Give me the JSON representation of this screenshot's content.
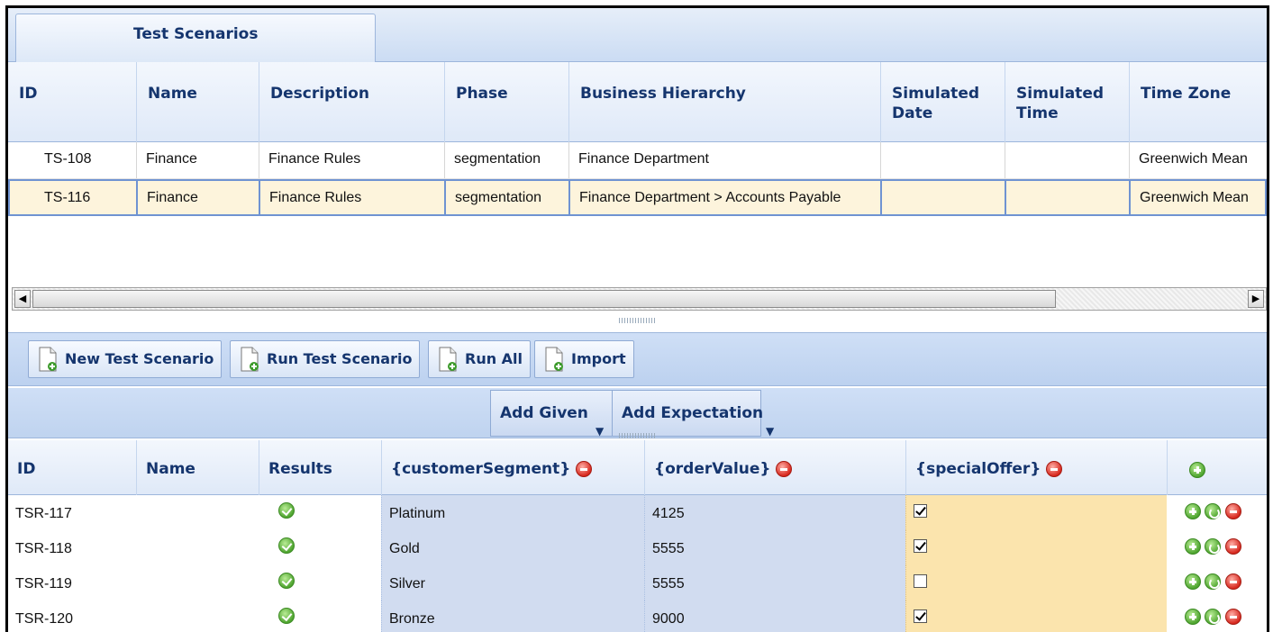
{
  "tabs": [
    {
      "label": "Test Scenarios"
    }
  ],
  "scenario_grid": {
    "columns": [
      "ID",
      "Name",
      "Description",
      "Phase",
      "Business Hierarchy",
      "Simulated Date",
      "Simulated Time",
      "Time Zone"
    ],
    "rows": [
      {
        "id": "TS-108",
        "name": "Finance",
        "description": "Finance Rules",
        "phase": "segmentation",
        "hierarchy": "Finance Department",
        "date": "",
        "time": "",
        "zone": "Greenwich Mean"
      },
      {
        "id": "TS-116",
        "name": "Finance",
        "description": "Finance Rules",
        "phase": "segmentation",
        "hierarchy": "Finance Department > Accounts Payable",
        "date": "",
        "time": "",
        "zone": "Greenwich Mean"
      }
    ],
    "selected_row": 1
  },
  "toolbar": {
    "new_label": "New Test Scenario",
    "run_label": "Run Test Scenario",
    "run_all_label": "Run All",
    "import_label": "Import"
  },
  "add_bar": {
    "given_label": "Add Given",
    "expectation_label": "Add Expectation"
  },
  "results_grid": {
    "columns": [
      "ID",
      "Name",
      "Results",
      "{customerSegment}",
      "{orderValue}",
      "{specialOffer}"
    ],
    "rows": [
      {
        "id": "TSR-117",
        "name": "",
        "result": "pass",
        "segment": "Platinum",
        "order": "4125",
        "offer": true
      },
      {
        "id": "TSR-118",
        "name": "",
        "result": "pass",
        "segment": "Gold",
        "order": "5555",
        "offer": true
      },
      {
        "id": "TSR-119",
        "name": "",
        "result": "pass",
        "segment": "Silver",
        "order": "5555",
        "offer": false
      },
      {
        "id": "TSR-120",
        "name": "",
        "result": "pass",
        "segment": "Bronze",
        "order": "9000",
        "offer": true
      }
    ]
  },
  "icons": {
    "result_pass": "check-circle-icon",
    "remove_column": "remove-circle-icon",
    "add": "add-circle-icon",
    "refresh": "refresh-icon",
    "document": "new-document-icon"
  },
  "colors": {
    "accent": "#15356e",
    "selected_row": "#fdf4dc",
    "given_column": "#d1dcf0",
    "expectation_column": "#fbe4ad"
  }
}
